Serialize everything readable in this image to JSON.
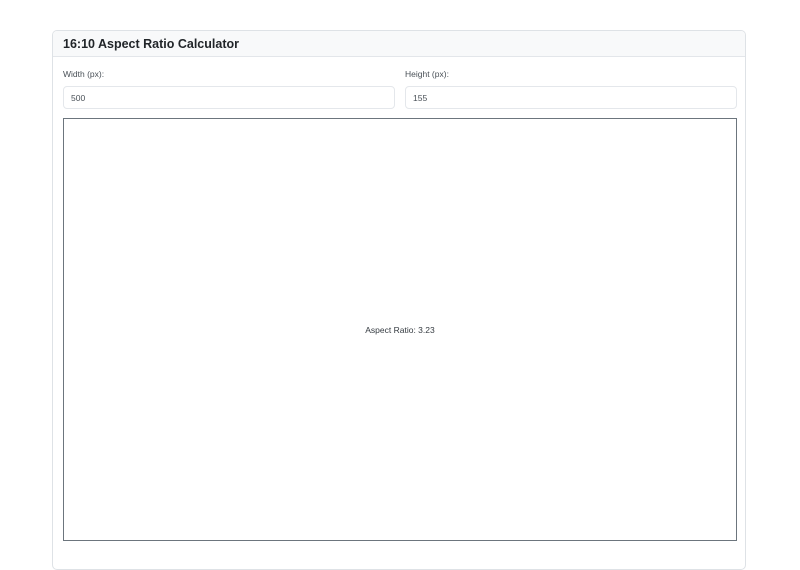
{
  "card": {
    "title": "16:10 Aspect Ratio Calculator"
  },
  "width_field": {
    "label": "Width (px):",
    "value": "500"
  },
  "height_field": {
    "label": "Height (px):",
    "value": "155"
  },
  "preview": {
    "ratio_text": "Aspect Ratio: 3.23"
  },
  "colors": {
    "header_bg": "#f8f9fa",
    "border": "#dee2e6",
    "preview_border": "#6c757d"
  }
}
